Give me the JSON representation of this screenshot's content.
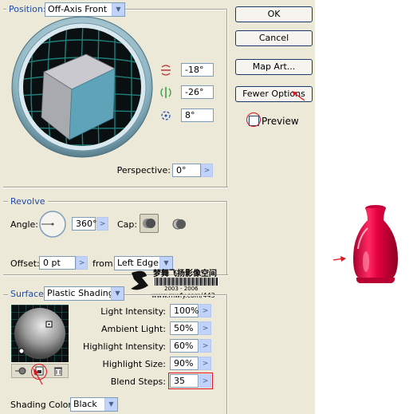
{
  "position": {
    "section_label": "Position:",
    "preset": "Off-Axis Front",
    "x_rotation": "-18°",
    "y_rotation": "-26°",
    "z_rotation": "8°",
    "perspective_label": "Perspective:",
    "perspective_value": "0°"
  },
  "buttons": {
    "ok": "OK",
    "cancel": "Cancel",
    "map_art": "Map Art...",
    "fewer_options": "Fewer Options"
  },
  "preview_label": "Preview",
  "revolve": {
    "section_label": "Revolve",
    "angle_label": "Angle:",
    "angle_value": "360°",
    "cap_label": "Cap:",
    "offset_label": "Offset:",
    "offset_value": "0 pt",
    "from_label": "from",
    "from_value": "Left Edge"
  },
  "surface": {
    "section_label": "Surface:",
    "type": "Plastic Shading",
    "light_intensity_label": "Light Intensity:",
    "light_intensity_value": "100%",
    "ambient_light_label": "Ambient Light:",
    "ambient_light_value": "50%",
    "highlight_intensity_label": "Highlight Intensity:",
    "highlight_intensity_value": "60%",
    "highlight_size_label": "Highlight Size:",
    "highlight_size_value": "90%",
    "blend_steps_label": "Blend Steps:",
    "blend_steps_value": "35",
    "shading_color_label": "Shading Color:",
    "shading_color_value": "Black"
  },
  "watermark": {
    "line1": "梦舞飞扬影像空间",
    "line2": "2003 - 2006",
    "line3": "www.mwfy.com/443"
  },
  "colors": {
    "cube_front": "#5fa3b8",
    "vase": "#e3003f",
    "annotation": "#e0141e",
    "section_label": "#1f4ba6"
  }
}
